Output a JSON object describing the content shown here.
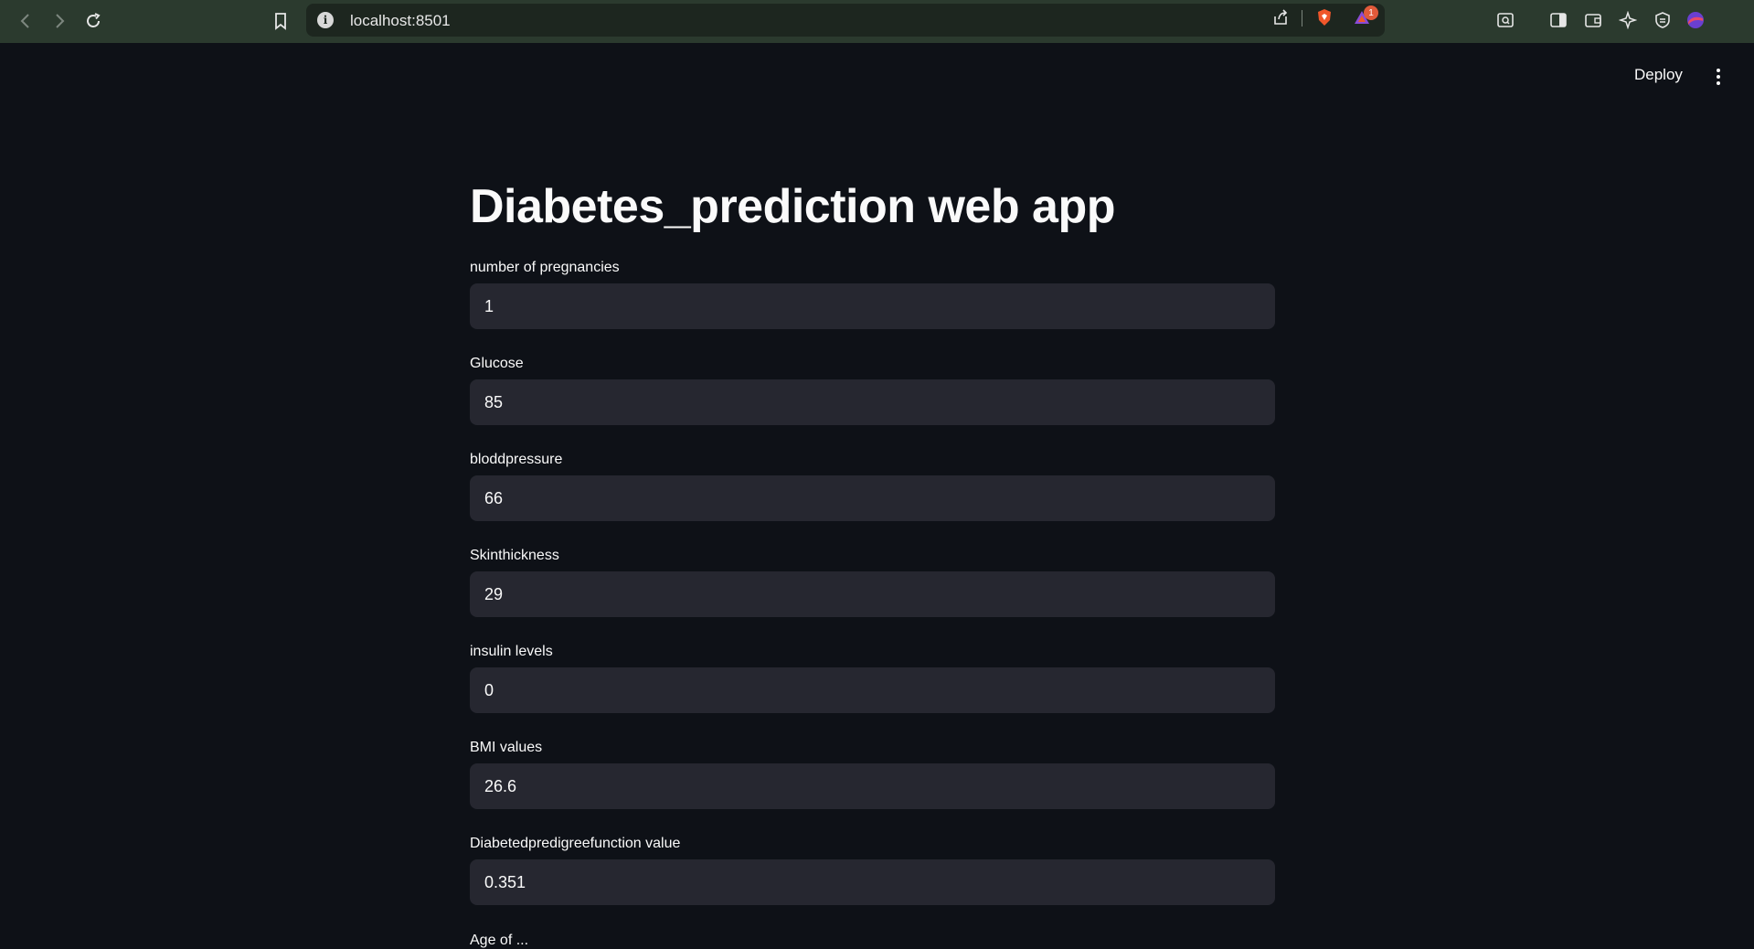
{
  "browser": {
    "url": "localhost:8501",
    "notification_count": "1"
  },
  "app": {
    "deploy_label": "Deploy",
    "title": "Diabetes_prediction web app"
  },
  "fields": [
    {
      "label": "number of pregnancies",
      "value": "1"
    },
    {
      "label": "Glucose",
      "value": "85"
    },
    {
      "label": "bloddpressure",
      "value": "66"
    },
    {
      "label": "Skinthickness",
      "value": "29"
    },
    {
      "label": "insulin levels",
      "value": "0"
    },
    {
      "label": "BMI values",
      "value": "26.6"
    },
    {
      "label": "Diabetedpredigreefunction value",
      "value": "0.351"
    }
  ],
  "partial_label": "Age of ..."
}
